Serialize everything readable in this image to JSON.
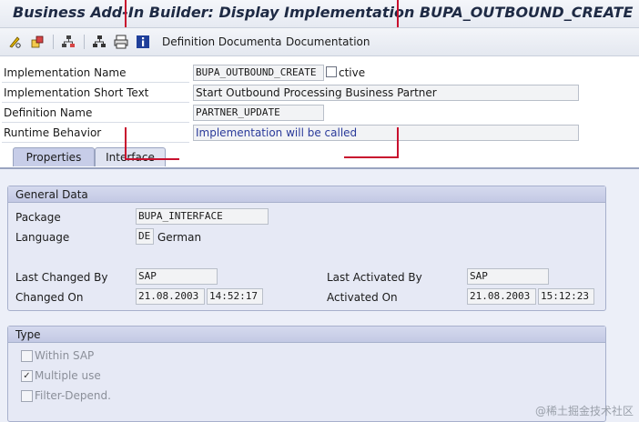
{
  "window": {
    "title": "Business Add-In Builder: Display Implementation BUPA_OUTBOUND_CREATE"
  },
  "toolbar": {
    "icons": [
      "pencil-glasses-icon",
      "object-switch-icon",
      "hierarchy-icon",
      "tree-icon",
      "printer-icon",
      "info-icon"
    ],
    "definition_doc_label": "Definition Documenta",
    "documentation_label": "Documentation"
  },
  "header": {
    "impl_name_label": "Implementation Name",
    "impl_name_value": "BUPA_OUTBOUND_CREATE",
    "impl_status": "ctive",
    "short_text_label": "Implementation Short Text",
    "short_text_value": "Start Outbound Processing Business Partner",
    "definition_label": "Definition Name",
    "definition_value": "PARTNER_UPDATE",
    "runtime_label": "Runtime Behavior",
    "runtime_value": "Implementation will be called"
  },
  "tabs": {
    "properties": "Properties",
    "interface": "Interface"
  },
  "general": {
    "title": "General Data",
    "package_label": "Package",
    "package_value": "BUPA_INTERFACE",
    "language_label": "Language",
    "language_code": "DE",
    "language_name": "German",
    "last_changed_by_label": "Last Changed By",
    "last_changed_by_value": "SAP",
    "changed_on_label": "Changed On",
    "changed_on_date": "21.08.2003",
    "changed_on_time": "14:52:17",
    "last_activated_by_label": "Last Activated By",
    "last_activated_by_value": "SAP",
    "activated_on_label": "Activated On",
    "activated_on_date": "21.08.2003",
    "activated_on_time": "15:12:23"
  },
  "type": {
    "title": "Type",
    "within_sap": "Within SAP",
    "multiple_use": "Multiple use",
    "filter_depend": "Filter-Depend."
  },
  "watermark": "@稀土掘金技术社区"
}
